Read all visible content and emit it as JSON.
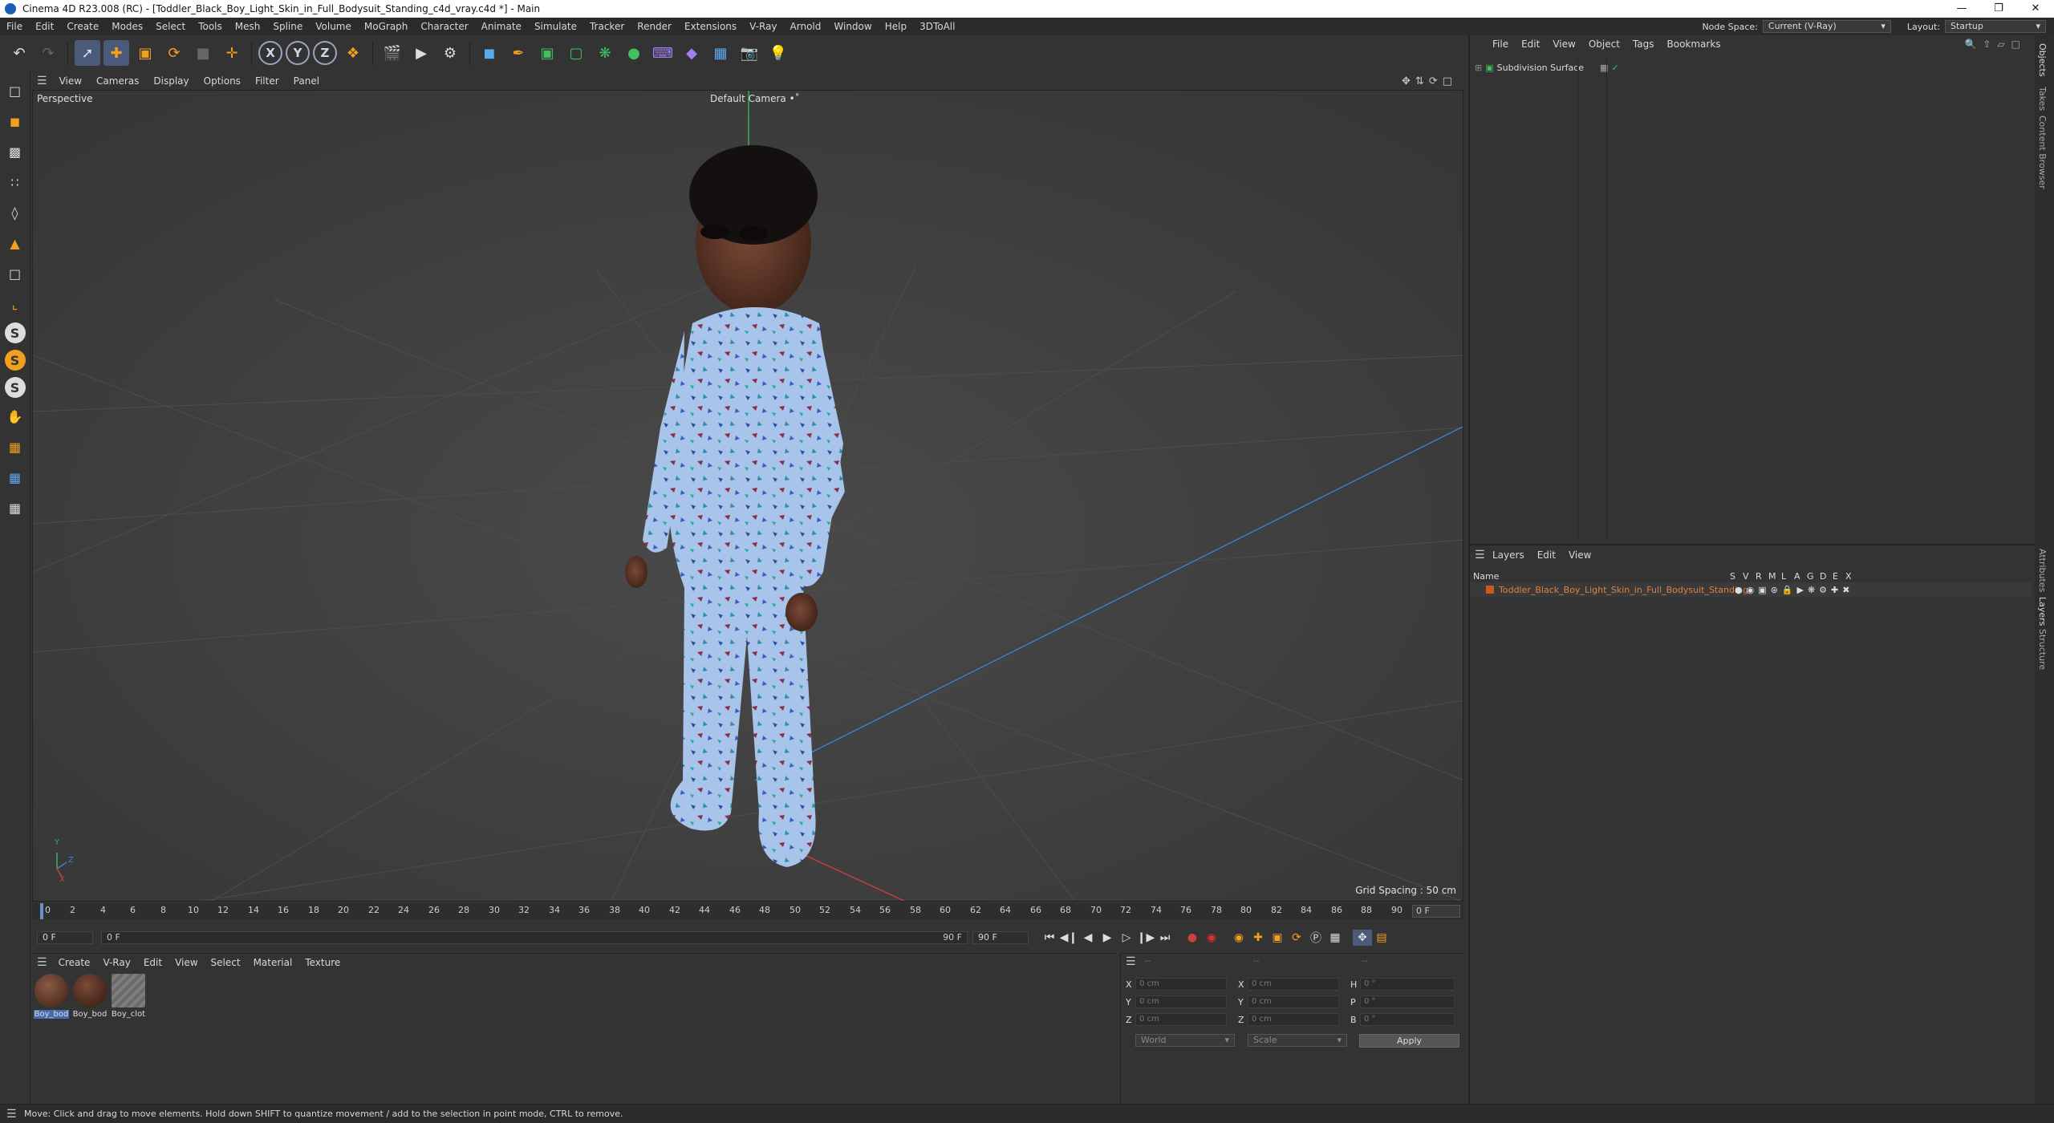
{
  "window": {
    "title": "Cinema 4D R23.008 (RC) - [Toddler_Black_Boy_Light_Skin_in_Full_Bodysuit_Standing_c4d_vray.c4d *] - Main"
  },
  "menubar": {
    "items": [
      "File",
      "Edit",
      "Create",
      "Modes",
      "Select",
      "Tools",
      "Mesh",
      "Spline",
      "Volume",
      "MoGraph",
      "Character",
      "Animate",
      "Simulate",
      "Tracker",
      "Render",
      "Extensions",
      "V-Ray",
      "Arnold",
      "Window",
      "Help",
      "3DToAll"
    ],
    "node_space_label": "Node Space:",
    "node_space_value": "Current (V-Ray)",
    "layout_label": "Layout:",
    "layout_value": "Startup"
  },
  "toolbar": {
    "axis_labels": [
      "X",
      "Y",
      "Z"
    ]
  },
  "viewport": {
    "menu": [
      "View",
      "Cameras",
      "Display",
      "Options",
      "Filter",
      "Panel"
    ],
    "projection": "Perspective",
    "camera": "Default Camera",
    "grid_spacing": "Grid Spacing : 50 cm",
    "gizmo_axes": [
      "Y",
      "Z",
      "X"
    ]
  },
  "timeline": {
    "ticks": [
      "0",
      "2",
      "4",
      "6",
      "8",
      "10",
      "12",
      "14",
      "16",
      "18",
      "20",
      "22",
      "24",
      "26",
      "28",
      "30",
      "32",
      "34",
      "36",
      "38",
      "40",
      "42",
      "44",
      "46",
      "48",
      "50",
      "52",
      "54",
      "56",
      "58",
      "60",
      "62",
      "64",
      "66",
      "68",
      "70",
      "72",
      "74",
      "76",
      "78",
      "80",
      "82",
      "84",
      "86",
      "88",
      "90"
    ],
    "current_frame": "0 F"
  },
  "playbar": {
    "start": "0 F",
    "range_start": "0 F",
    "range_end": "90 F",
    "end": "90 F"
  },
  "material_manager": {
    "menu": [
      "Create",
      "V-Ray",
      "Edit",
      "View",
      "Select",
      "Material",
      "Texture"
    ],
    "materials": [
      {
        "name": "Boy_bod",
        "color": "#5a3325"
      },
      {
        "name": "Boy_bod",
        "color": "#4d2a1f"
      },
      {
        "name": "Boy_clot",
        "color": "#777777"
      }
    ]
  },
  "coordinates": {
    "rows": [
      {
        "a": "X",
        "av": "0 cm",
        "b": "X",
        "bv": "0 cm",
        "c": "H",
        "cv": "0 °"
      },
      {
        "a": "Y",
        "av": "0 cm",
        "b": "Y",
        "bv": "0 cm",
        "c": "P",
        "cv": "0 °"
      },
      {
        "a": "Z",
        "av": "0 cm",
        "b": "Z",
        "bv": "0 cm",
        "c": "B",
        "cv": "0 °"
      }
    ],
    "header_dashes": [
      "--",
      "--",
      "--"
    ],
    "space": "World",
    "mode": "Scale",
    "apply": "Apply"
  },
  "object_manager": {
    "menu": [
      "File",
      "Edit",
      "View",
      "Object",
      "Tags",
      "Bookmarks"
    ],
    "objects": [
      "Subdivision Surface"
    ]
  },
  "layer_manager": {
    "menu": [
      "Layers",
      "Edit",
      "View"
    ],
    "name_header": "Name",
    "columns": [
      "S",
      "V",
      "R",
      "M",
      "L",
      "A",
      "G",
      "D",
      "E",
      "X"
    ],
    "layers": [
      "Toddler_Black_Boy_Light_Skin_in_Full_Bodysuit_Standing"
    ]
  },
  "side_tabs": [
    "Objects",
    "Takes",
    "Content Browser",
    "Attributes",
    "Layers",
    "Structure"
  ],
  "status": {
    "text": "Move: Click and drag to move elements. Hold down SHIFT to quantize movement / add to the selection in point mode, CTRL to remove."
  }
}
